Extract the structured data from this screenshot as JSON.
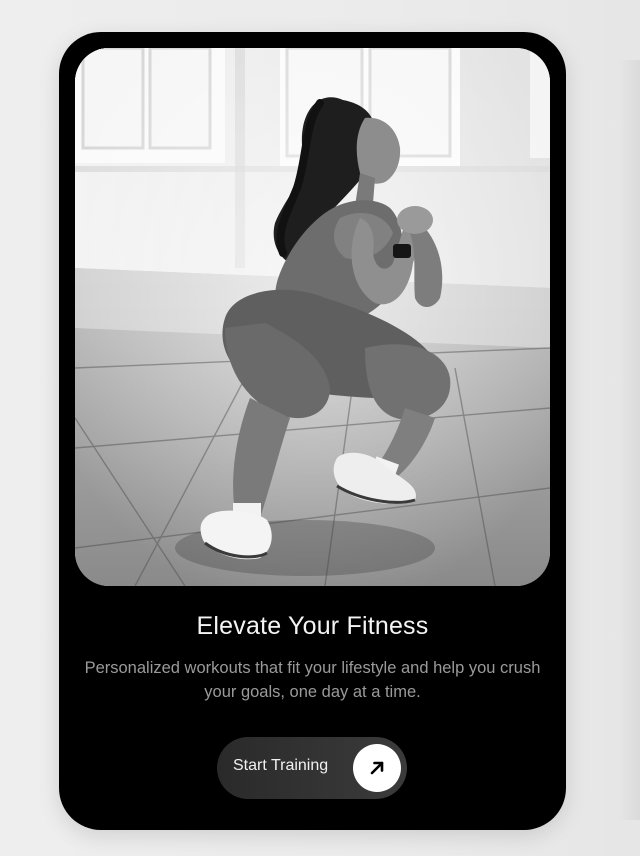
{
  "card": {
    "title": "Elevate Your Fitness",
    "description": "Personalized workouts that fit your lifestyle and help you crush your goals, one day at a time.",
    "cta_label": "Start Training",
    "cta_icon": "arrow-up-right-icon"
  },
  "colors": {
    "card_background": "#000000",
    "page_background": "#ececec",
    "title_text": "#f4f4f4",
    "description_text": "#9a9a9a",
    "cta_background": "#333333",
    "cta_icon_circle": "#ffffff"
  },
  "photo": {
    "subject": "woman-squatting-fitness-photo"
  }
}
